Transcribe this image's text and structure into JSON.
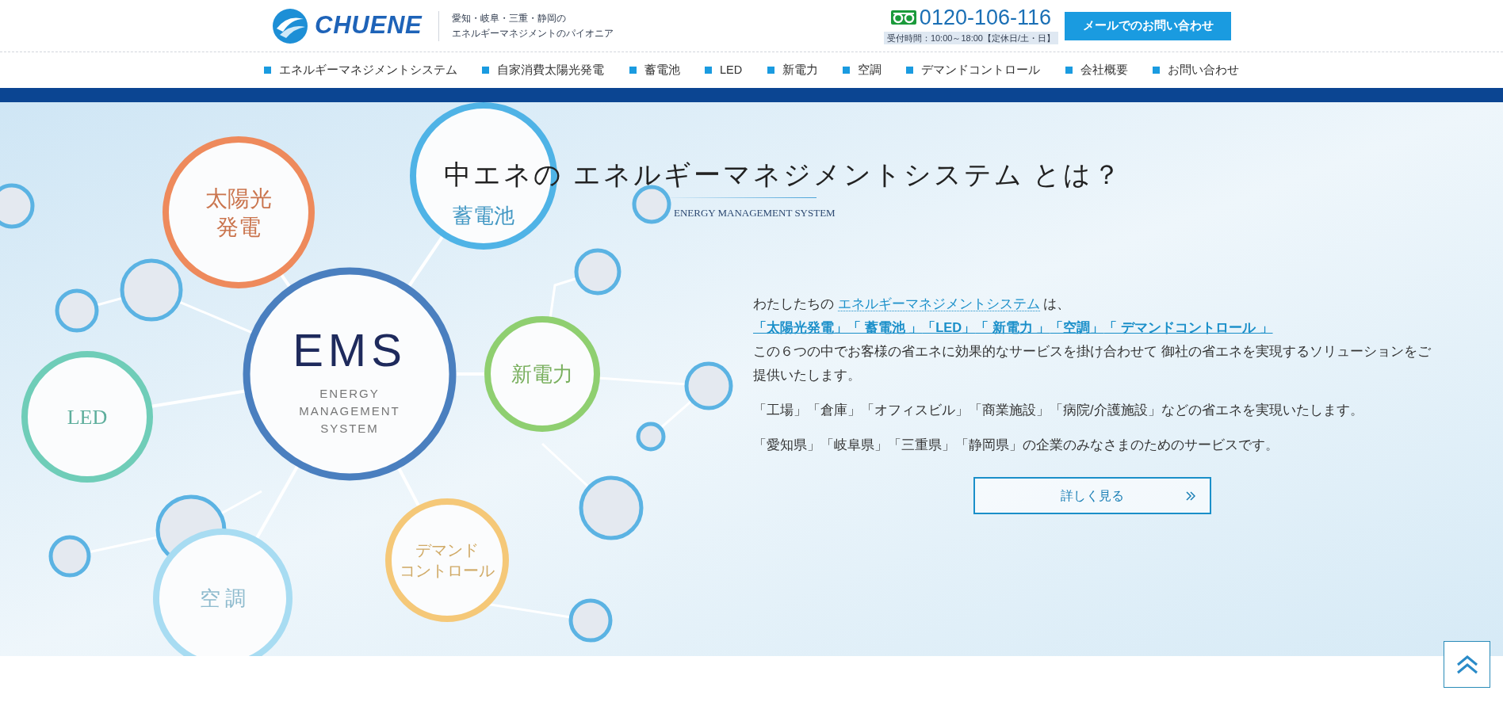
{
  "header": {
    "logo": "CHUENE",
    "tagline": [
      "愛知・岐阜・三重・静岡の",
      "エネルギーマネジメントのパイオニア"
    ],
    "phone": "0120-106-116",
    "hours": "受付時間：10:00～18:00【定休日/土・日】",
    "mail_button": "メールでのお問い合わせ"
  },
  "nav": [
    "エネルギーマネジメントシステム",
    "自家消費太陽光発電",
    "蓄電池",
    "LED",
    "新電力",
    "空調",
    "デマンドコントロール",
    "会社概要",
    "お問い合わせ"
  ],
  "hero": {
    "title": "中エネの エネルギーマネジメントシステム とは？",
    "subtitle": "ENERGY MANAGEMENT SYSTEM",
    "diagram": {
      "center": {
        "title": "EMS",
        "subtitle": [
          "ENERGY",
          "MANAGEMENT",
          "SYSTEM"
        ]
      },
      "nodes": [
        {
          "label": [
            "太陽光",
            "発電"
          ],
          "color": "#ee8a5c"
        },
        {
          "label": [
            "蓄電池"
          ],
          "color": "#4fb3e6"
        },
        {
          "label": [
            "新電力"
          ],
          "color": "#8fcf70"
        },
        {
          "label": [
            "LED"
          ],
          "color": "#6fcdb8"
        },
        {
          "label": [
            "デマンド",
            "コントロール"
          ],
          "color": "#f5c878"
        },
        {
          "label": [
            "空 調"
          ],
          "color": "#a8dcf2"
        }
      ]
    },
    "intro": {
      "before": "わたしたちの",
      "link": "エネルギーマネジメントシステム",
      "after": "は、"
    },
    "links": [
      "「太陽光発電」",
      "「 蓄電池 」",
      "「LED」",
      "「 新電力 」",
      "「空調」",
      "「 デマンドコントロール 」"
    ],
    "paragraphs": [
      "この６つの中でお客様の省エネに効果的なサービスを掛け合わせて 御社の省エネを実現するソリューションをご提供いたします。",
      "「工場」「倉庫」「オフィスビル」「商業施設」「病院/介護施設」などの省エネを実現いたします。",
      "「愛知県」「岐阜県」「三重県」「静岡県」の企業のみなさまのためのサービスです。"
    ],
    "button": "詳しく見る"
  }
}
